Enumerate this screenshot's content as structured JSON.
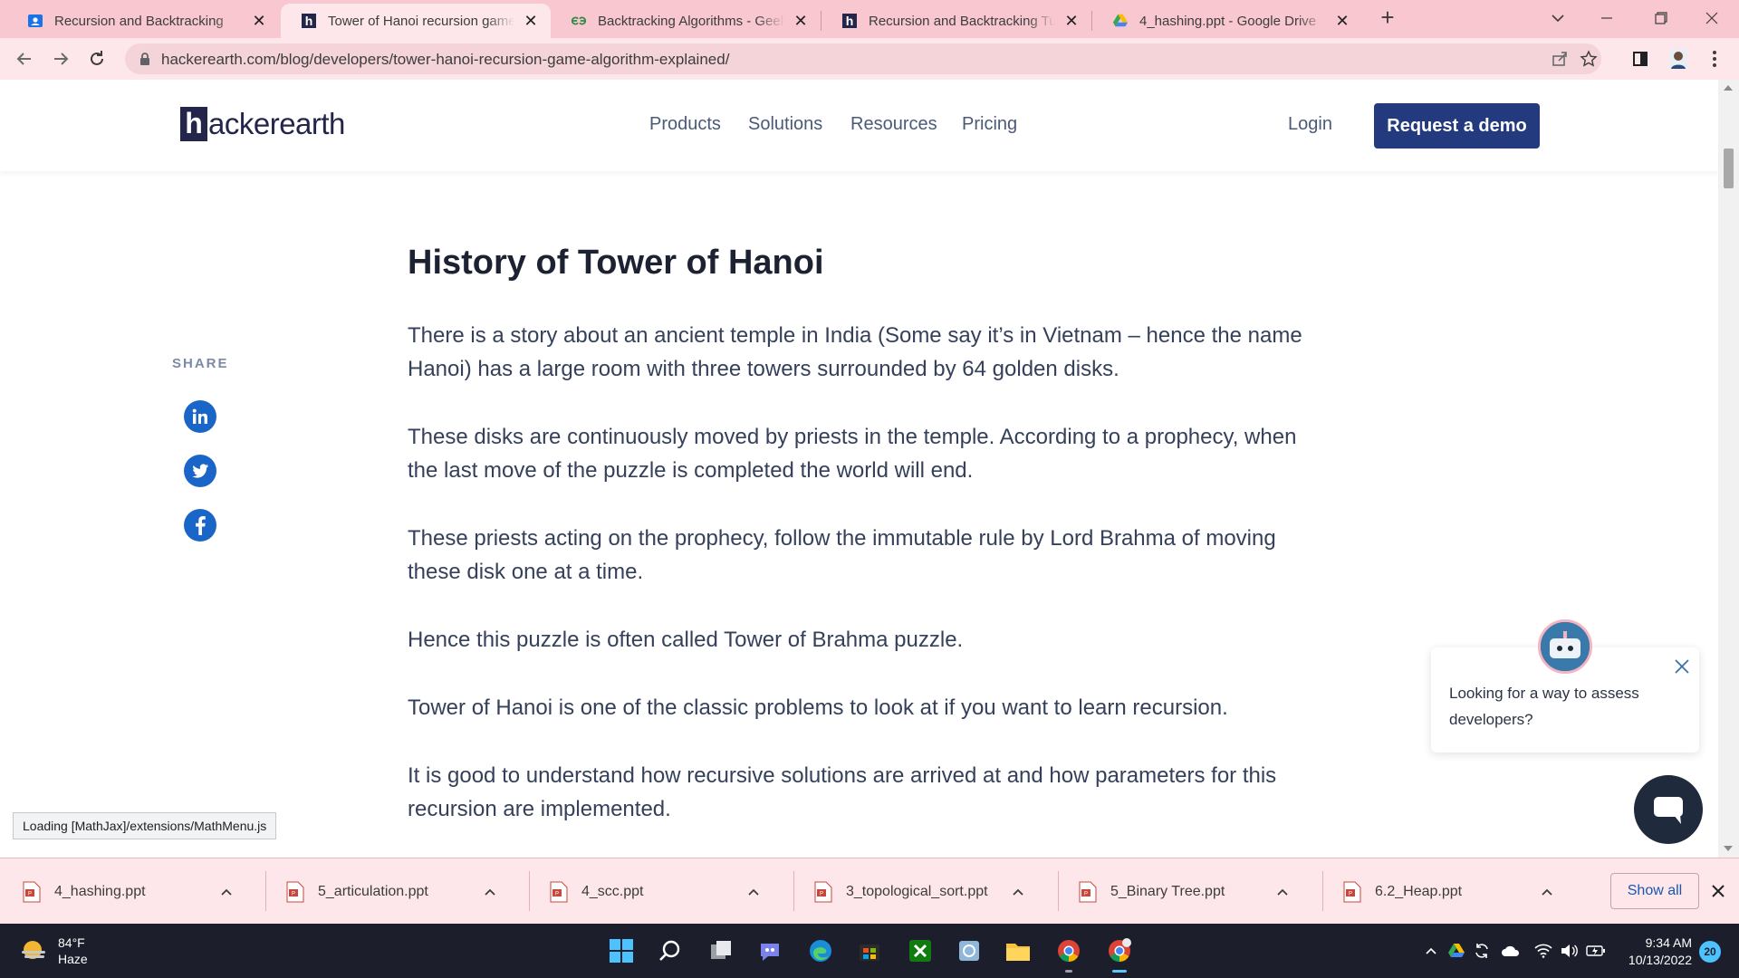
{
  "browser": {
    "tabs": [
      {
        "title": "Recursion and Backtracking",
        "icon": "classroom-icon"
      },
      {
        "title": "Tower of Hanoi recursion game algorithm explained",
        "icon": "hackerearth-icon",
        "active": true
      },
      {
        "title": "Backtracking Algorithms - GeeksforGeeks",
        "icon": "geeksforgeeks-icon"
      },
      {
        "title": "Recursion and Backtracking Tutorials",
        "icon": "hackerearth-icon"
      },
      {
        "title": "4_hashing.ppt - Google Drive",
        "icon": "google-drive-icon"
      }
    ],
    "url": "hackerearth.com/blog/developers/tower-hanoi-recursion-game-algorithm-explained/"
  },
  "site": {
    "logo_h": "h",
    "logo_rest": "ackerearth",
    "nav": [
      "Products",
      "Solutions",
      "Resources",
      "Pricing"
    ],
    "login": "Login",
    "demo": "Request a demo"
  },
  "share": {
    "label": "SHARE",
    "networks": [
      "linkedin-icon",
      "twitter-icon",
      "facebook-icon"
    ]
  },
  "article": {
    "title": "History of Tower of Hanoi",
    "paragraphs": [
      "There is a story about an ancient temple in India (Some say it’s in Vietnam – hence the name Hanoi) has a large room with three towers surrounded by 64 golden disks.",
      "These disks are continuously moved by priests in the temple. According to a prophecy, when the last move of the puzzle is completed the world will end.",
      "These priests acting on the prophecy, follow the immutable rule by Lord Brahma of moving these disk one at a time.",
      "Hence this puzzle is often called Tower of Brahma puzzle.",
      "Tower of Hanoi is one of the classic problems to look at if you want to learn recursion.",
      "It is good to understand how recursive solutions are arrived at and how parameters for this recursion are implemented."
    ]
  },
  "chat": {
    "message": "Looking for a way to assess developers?"
  },
  "status_bubble": "Loading [MathJax]/extensions/MathMenu.js",
  "downloads": {
    "items": [
      "4_hashing.ppt",
      "5_articulation.ppt",
      "4_scc.ppt",
      "3_topological_sort.ppt",
      "5_Binary Tree.ppt",
      "6.2_Heap.ppt"
    ],
    "show_all": "Show all"
  },
  "taskbar": {
    "temperature": "84°F",
    "condition": "Haze",
    "time": "9:34 AM",
    "date": "10/13/2022",
    "notifications": "20",
    "apps": [
      "windows-start-icon",
      "search-icon",
      "task-view-icon",
      "teams-chat-icon",
      "edge-icon",
      "store-icon",
      "xbox-icon",
      "photos-icon",
      "file-explorer-icon",
      "chrome-icon",
      "chrome-profile-icon"
    ]
  },
  "colors": {
    "chrome_frame": "#f8c7cf",
    "chrome_toolbar": "#fde7ea",
    "brand_navy": "#233a7e",
    "share_blue": "#1a66c8",
    "taskbar": "#1c1f2b"
  }
}
